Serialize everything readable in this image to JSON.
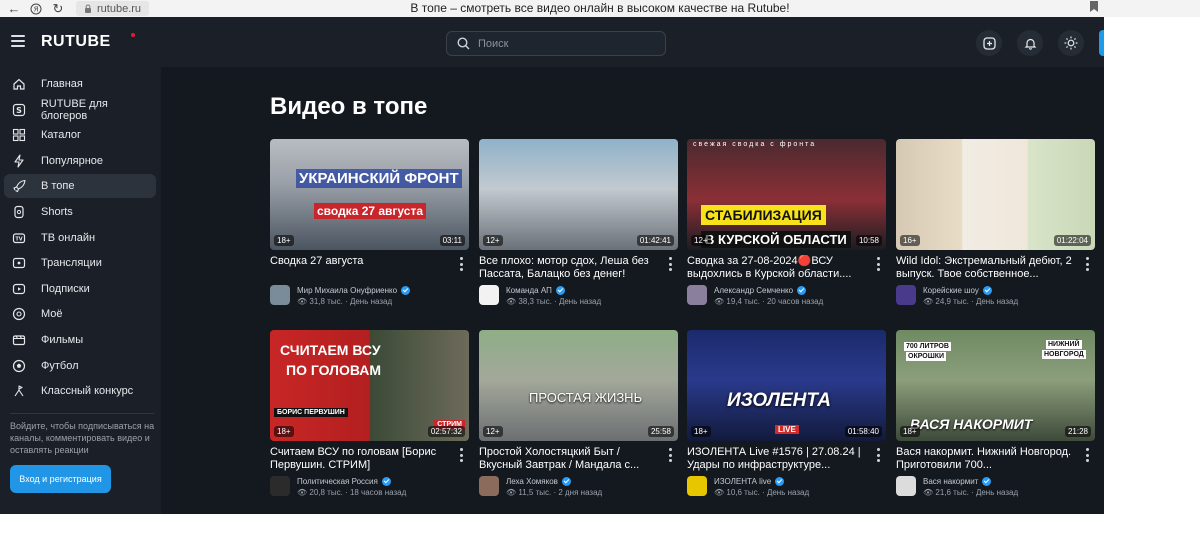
{
  "browser": {
    "url": "rutube.ru",
    "title": "В топе – смотреть все видео онлайн в высоком качестве на Rutube!"
  },
  "header": {
    "logo": "RUTUBE",
    "search_placeholder": "Поиск"
  },
  "sidebar": {
    "items": [
      {
        "label": "Главная",
        "icon": "home-icon"
      },
      {
        "label": "RUTUBE для блогеров",
        "icon": "bloggers-icon"
      },
      {
        "label": "Каталог",
        "icon": "catalog-icon"
      },
      {
        "label": "Популярное",
        "icon": "lightning-icon"
      },
      {
        "label": "В топе",
        "icon": "rocket-icon"
      },
      {
        "label": "Shorts",
        "icon": "shorts-icon"
      },
      {
        "label": "ТВ онлайн",
        "icon": "tv-icon"
      },
      {
        "label": "Трансляции",
        "icon": "broadcast-icon"
      },
      {
        "label": "Подписки",
        "icon": "subscriptions-icon"
      },
      {
        "label": "Моё",
        "icon": "my-icon"
      },
      {
        "label": "Фильмы",
        "icon": "film-icon"
      },
      {
        "label": "Футбол",
        "icon": "football-icon"
      },
      {
        "label": "Классный конкурс",
        "icon": "contest-icon"
      }
    ],
    "active_index": 4,
    "hint": "Войдите, чтобы подписываться на каналы, комментировать видео и оставлять реакции",
    "login_label": "Вход и регистрация"
  },
  "main": {
    "title": "Видео в топе",
    "videos": [
      {
        "title": "Сводка 27 августа",
        "age": "18+",
        "duration": "03:11",
        "channel": "Мир Михаила Онуфриенко",
        "views": "31,8 тыс.",
        "time": "День назад",
        "overlay": [
          "УКРАИНСКИЙ ФРОНТ",
          "сводка 27 августа"
        ]
      },
      {
        "title": "Все плохо: мотор сдох, Леша без Пассата, Балацко без денег!",
        "age": "12+",
        "duration": "01:42:41",
        "channel": "Команда АП",
        "views": "38,3 тыс.",
        "time": "День назад",
        "overlay": []
      },
      {
        "title": "Сводка за 27-08-2024🔴ВСУ выдохлись в Курской области....",
        "age": "12+",
        "duration": "10:58",
        "channel": "Александр Семченко",
        "views": "19,4 тыс.",
        "time": "20 часов назад",
        "overlay": [
          "свежая сводка с фронта",
          "СТАБИЛИЗАЦИЯ",
          "В КУРСКОЙ ОБЛАСТИ"
        ]
      },
      {
        "title": "Wild Idol: Экстремальный дебют, 2 выпуск. Твое собственное...",
        "age": "16+",
        "duration": "01:22:04",
        "channel": "Корейские шоу",
        "views": "24,9 тыс.",
        "time": "День назад",
        "overlay": []
      },
      {
        "title": "Считаем ВСУ по головам [Борис Первушин. СТРИМ]",
        "age": "18+",
        "duration": "02:57:32",
        "channel": "Политическая Россия",
        "views": "20,8 тыс.",
        "time": "18 часов назад",
        "overlay": [
          "СЧИТАЕМ ВСУ",
          "ПО ГОЛОВАМ",
          "БОРИС ПЕРВУШИН",
          "СТРИМ"
        ]
      },
      {
        "title": "Простой Холостяцкий Быт / Вкусный Завтрак / Мандала с...",
        "age": "12+",
        "duration": "25:58",
        "channel": "Леха Хомяков",
        "views": "11,5 тыс.",
        "time": "2 дня назад",
        "overlay": [
          "ПРОСТАЯ ЖИЗНЬ"
        ]
      },
      {
        "title": "ИЗОЛЕНТА Live #1576 | 27.08.24 | Удары по инфраструктуре...",
        "age": "18+",
        "duration": "01:58:40",
        "channel": "ИЗОЛЕНТА live",
        "views": "10,6 тыс.",
        "time": "День назад",
        "overlay": [
          "ИЗОЛЕНТА",
          "LIVE"
        ]
      },
      {
        "title": "Вася накормит. Нижний Новгород. Приготовили 700...",
        "age": "18+",
        "duration": "21:28",
        "channel": "Вася накормит",
        "views": "21,6 тыс.",
        "time": "День назад",
        "overlay": [
          "700 ЛИТРОВ",
          "ОКРОШКИ",
          "НИЖНИЙ",
          "НОВГОРОД",
          "ВАСЯ НАКОРМИТ"
        ]
      }
    ]
  },
  "colors": {
    "background": "#14191f",
    "panel": "#1b2028",
    "accent": "#2196e6",
    "logo_dot": "#ed143b"
  }
}
